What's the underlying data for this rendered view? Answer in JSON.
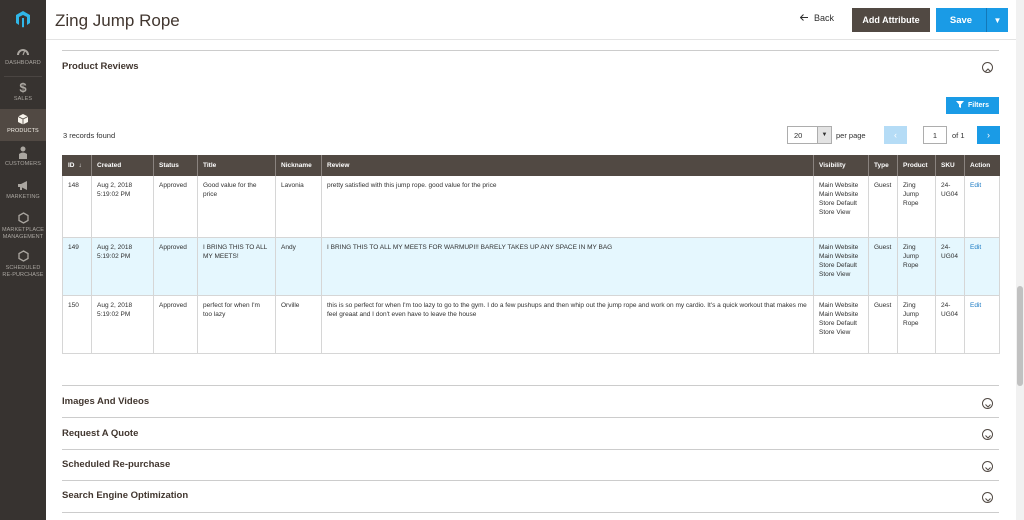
{
  "nav": {
    "items": [
      {
        "label": "DASHBOARD",
        "icon": "dashboard-icon"
      },
      {
        "label": "SALES",
        "icon": "dollar-icon"
      },
      {
        "label": "PRODUCTS",
        "icon": "box-icon"
      },
      {
        "label": "CUSTOMERS",
        "icon": "person-icon"
      },
      {
        "label": "MARKETING",
        "icon": "megaphone-icon"
      },
      {
        "label": "MARKETPLACE MANAGEMENT",
        "icon": "hexagon-icon"
      },
      {
        "label": "SCHEDULED RE-PURCHASE",
        "icon": "hexagon-icon"
      }
    ]
  },
  "header": {
    "title": "Zing Jump Rope",
    "back_label": "Back",
    "add_attribute_label": "Add Attribute",
    "save_label": "Save"
  },
  "reviews": {
    "section_title": "Product Reviews",
    "filters_label": "Filters",
    "records_found": "3 records found",
    "per_page_value": "20",
    "per_page_label": "per page",
    "current_page": "1",
    "of_pages": "of 1",
    "columns": [
      "ID",
      "Created",
      "Status",
      "Title",
      "Nickname",
      "Review",
      "Visibility",
      "Type",
      "Product",
      "SKU",
      "Action"
    ],
    "rows": [
      {
        "id": "148",
        "created": "Aug 2, 2018 5:19:02 PM",
        "status": "Approved",
        "title": "Good value for the price",
        "nickname": "Lavonia",
        "review": "pretty satisfied with this jump rope. good value for the price",
        "visibility": "Main Website Main Website Store Default Store View",
        "type": "Guest",
        "product": "Zing Jump Rope",
        "sku": "24-UG04",
        "action": "Edit"
      },
      {
        "id": "149",
        "created": "Aug 2, 2018 5:19:02 PM",
        "status": "Approved",
        "title": "I BRING THIS TO ALL MY MEETS!",
        "nickname": "Andy",
        "review": "I BRING THIS TO ALL MY MEETS FOR WARMUPI!! BARELY TAKES UP ANY SPACE IN MY BAG",
        "visibility": "Main Website Main Website Store Default Store View",
        "type": "Guest",
        "product": "Zing Jump Rope",
        "sku": "24-UG04",
        "action": "Edit"
      },
      {
        "id": "150",
        "created": "Aug 2, 2018 5:19:02 PM",
        "status": "Approved",
        "title": "perfect for when I'm too lazy",
        "nickname": "Orville",
        "review": "this is so perfect for when I'm too lazy to go to the gym. I do a few pushups and then whip out the jump rope and work on my cardio. It's a quick workout that makes me feel greaat and I don't even have to leave the house",
        "visibility": "Main Website Main Website Store Default Store View",
        "type": "Guest",
        "product": "Zing Jump Rope",
        "sku": "24-UG04",
        "action": "Edit"
      }
    ]
  },
  "sections": [
    {
      "title": "Images And Videos"
    },
    {
      "title": "Request A Quote"
    },
    {
      "title": "Scheduled Re-purchase"
    },
    {
      "title": "Search Engine Optimization"
    }
  ],
  "colors": {
    "sidebar": "#373330",
    "header_dark": "#514943",
    "accent": "#1a9be6",
    "row_highlight": "#e5f7fe"
  }
}
